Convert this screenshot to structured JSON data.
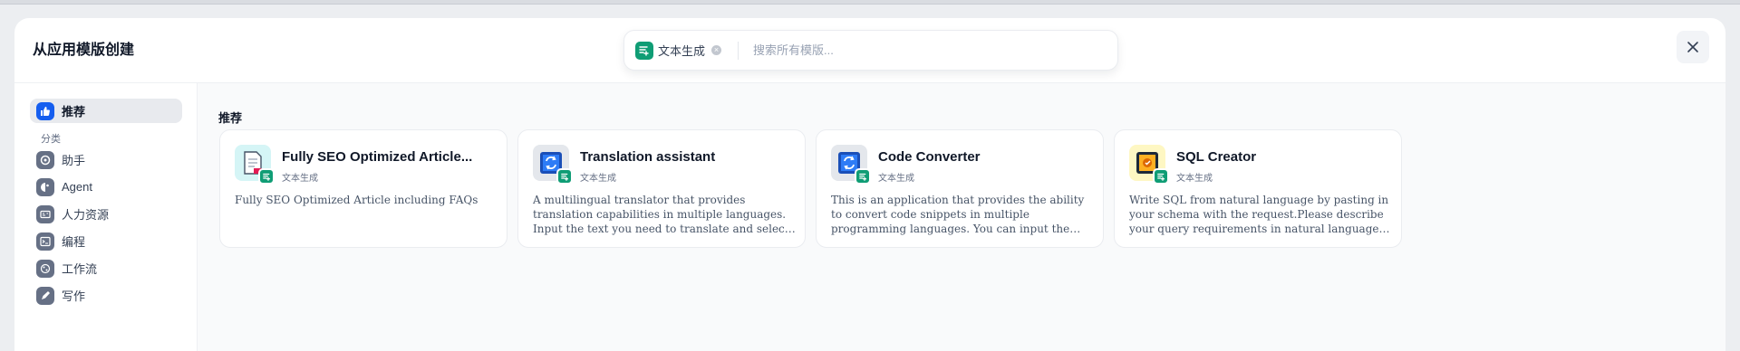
{
  "dialog": {
    "title": "从应用模版创建"
  },
  "search": {
    "chip_label": "文本生成",
    "placeholder": "搜索所有模版..."
  },
  "sidebar": {
    "recommended_label": "推荐",
    "category_heading": "分类",
    "categories": [
      {
        "label": "助手",
        "icon": "assistant-icon"
      },
      {
        "label": "Agent",
        "icon": "agent-icon"
      },
      {
        "label": "人力资源",
        "icon": "id-card-icon"
      },
      {
        "label": "编程",
        "icon": "terminal-icon"
      },
      {
        "label": "工作流",
        "icon": "workflow-icon"
      },
      {
        "label": "写作",
        "icon": "pen-icon"
      }
    ]
  },
  "main": {
    "section_title": "推荐",
    "cards": [
      {
        "name": "Fully SEO Optimized Article...",
        "type": "文本生成",
        "description": "Fully SEO Optimized Article including FAQs",
        "icon": "document-icon",
        "icon_bg": "#d5f5f6"
      },
      {
        "name": "Translation assistant",
        "type": "文本生成",
        "description": "A multilingual translator that provides translation capabilities in multiple languages. Input the text you need to translate and select the target...",
        "icon": "translate-icon",
        "icon_bg": "#e4e7ec"
      },
      {
        "name": "Code Converter",
        "type": "文本生成",
        "description": "This is an application that provides the ability to convert code snippets in multiple programming languages. You can input the code you wish to...",
        "icon": "convert-icon",
        "icon_bg": "#e4e7ec"
      },
      {
        "name": "SQL Creator",
        "type": "文本生成",
        "description": "Write SQL from natural language by pasting in your schema with the request.Please describe your query requirements in natural language a...",
        "icon": "sql-icon",
        "icon_bg": "#fef7c3"
      }
    ]
  },
  "colors": {
    "accent_green": "#0f9d75",
    "accent_blue": "#155eef"
  }
}
